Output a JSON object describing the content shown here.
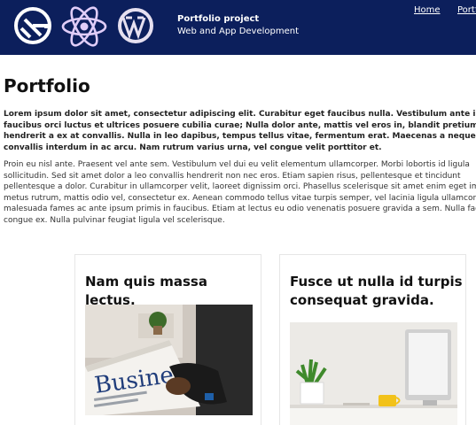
{
  "header": {
    "title": "Portfolio project",
    "subtitle": "Web and App Development",
    "logos": [
      "gatsby-icon",
      "react-icon",
      "wordpress-icon"
    ],
    "nav": [
      {
        "label": "Home"
      },
      {
        "label": "Portfolio"
      }
    ],
    "colors": {
      "background": "#0c1f5c",
      "text": "#ffffff"
    }
  },
  "main": {
    "title": "Portfolio",
    "lead_lines": [
      "Lorem ipsum dolor sit amet, consectetur adipiscing elit. Curabitur eget faucibus nulla. Vestibulum ante ipsum",
      "faucibus orci luctus et ultrices posuere cubilia curae; Nulla dolor ante, mattis vel eros in, blandit pretium tellus",
      "hendrerit a ex at convallis. Nulla in leo dapibus, tempus tellus vitae, fermentum erat. Maecenas a neque ac",
      "convallis interdum in ac arcu. Nam rutrum varius urna, vel congue velit porttitor et."
    ],
    "body_lines": [
      "Proin eu nisl ante. Praesent vel ante sem. Vestibulum vel dui eu velit elementum ullamcorper. Morbi lobortis id ligula",
      "sollicitudin. Sed sit amet dolor a leo convallis hendrerit non nec eros. Etiam sapien risus, pellentesque et tincidunt",
      "pellentesque a dolor. Curabitur in ullamcorper velit, laoreet dignissim orci. Phasellus scelerisque sit amet enim eget imperdiet.",
      "metus rutrum, mattis odio vel, consectetur ex. Aenean commodo tellus vitae turpis semper, vel lacinia ligula ullamcorper.",
      "malesuada fames ac ante ipsum primis in faucibus. Etiam at lectus eu odio venenatis posuere gravida a sem. Nulla facilisi.",
      "congue ex. Nulla pulvinar feugiat ligula vel scelerisque."
    ],
    "cards": [
      {
        "title": "Nam quis massa lectus.",
        "image_text": "Business"
      },
      {
        "title": "Fusce ut nulla id turpis consequat gravida."
      }
    ]
  }
}
